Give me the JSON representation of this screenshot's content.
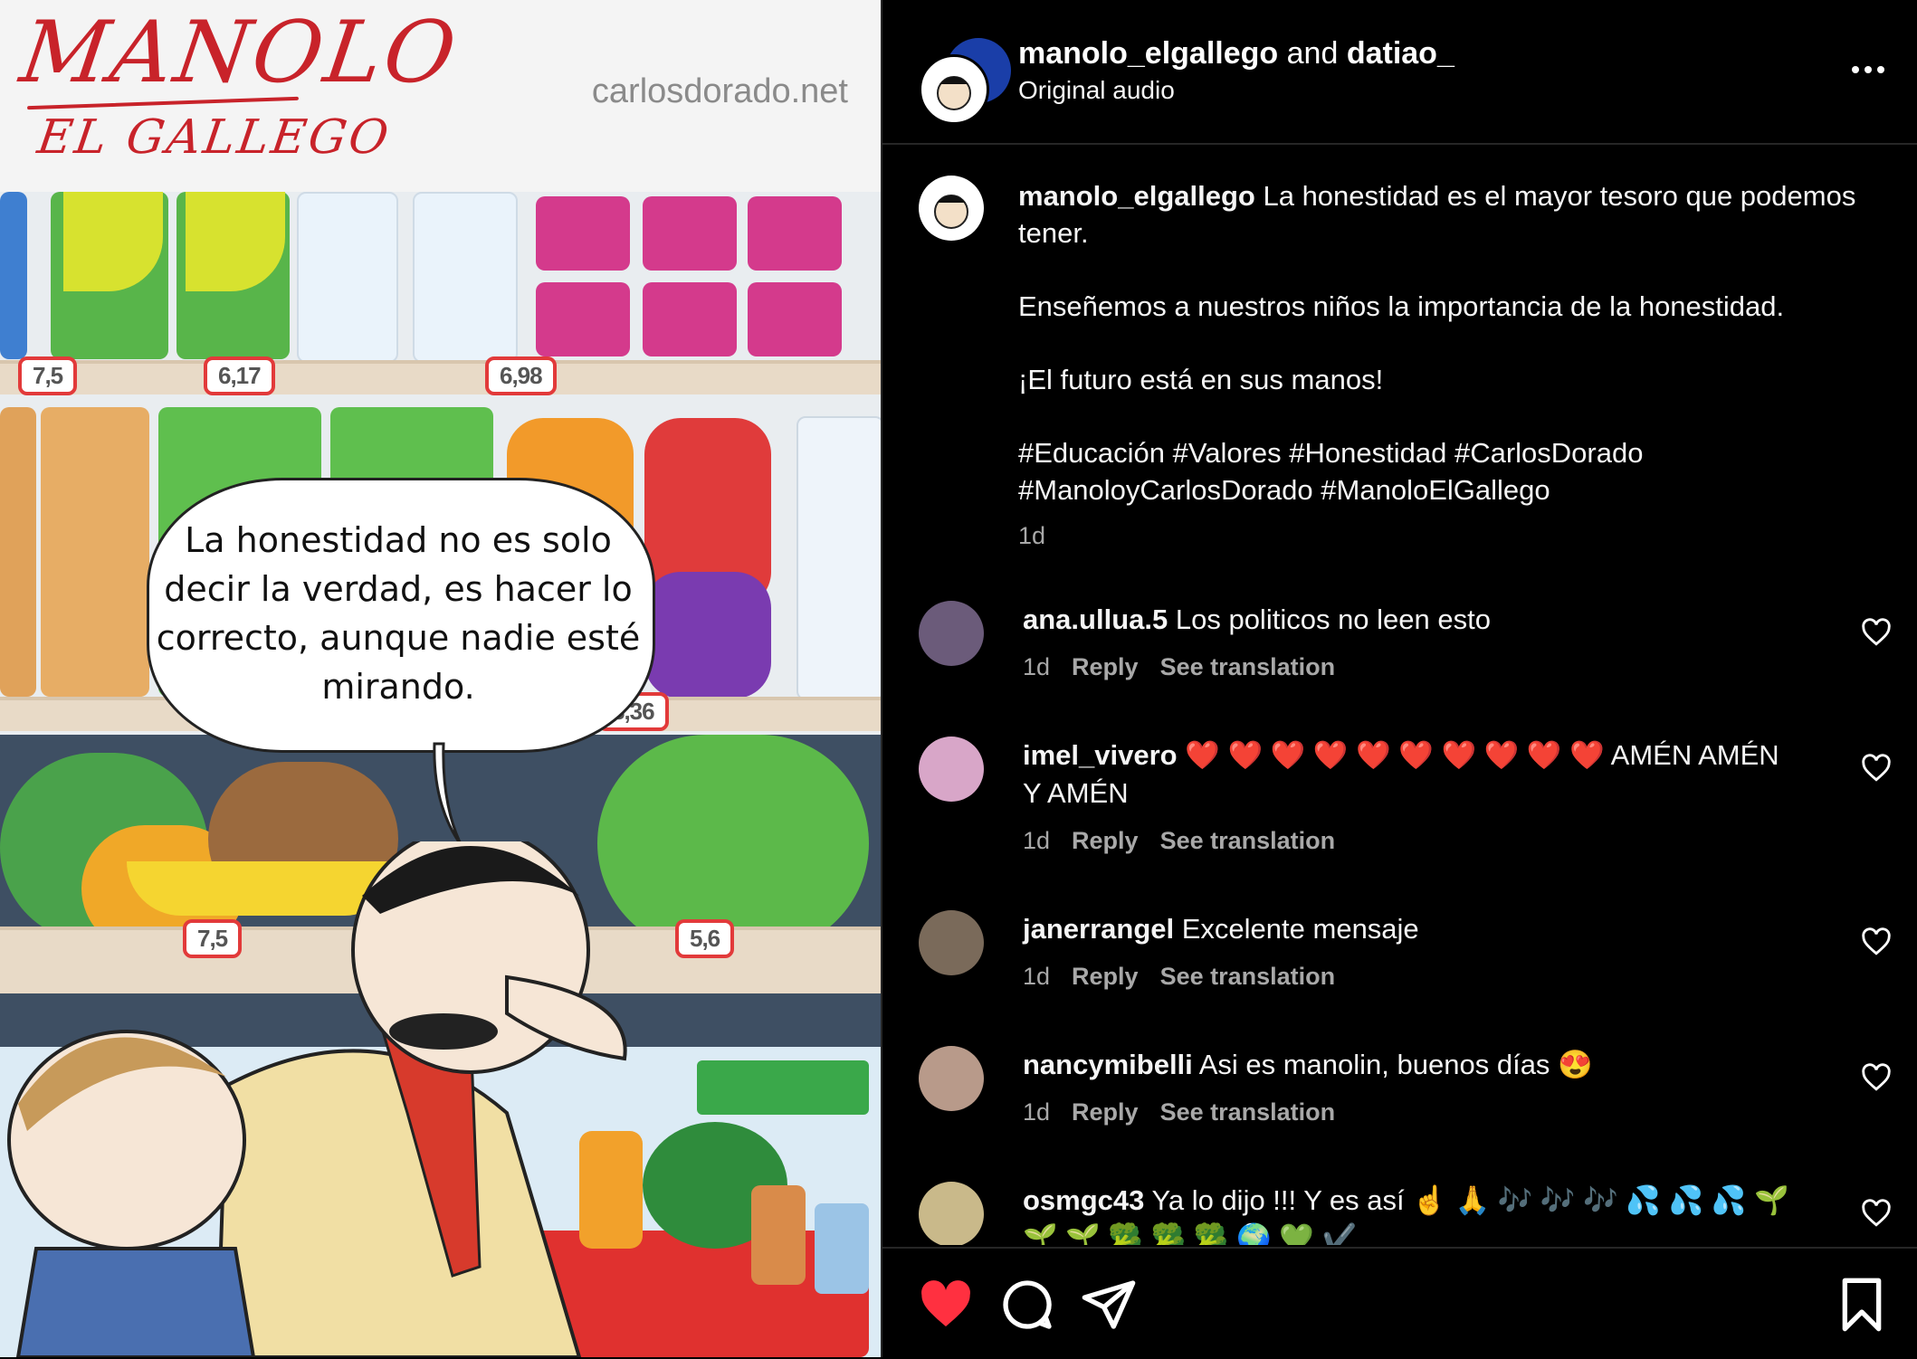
{
  "comic": {
    "logo_main": "MANOLO",
    "logo_sub": "EL GALLEGO",
    "site_url": "carlosdorado.net",
    "prices": [
      "7,5",
      "6,17",
      "6,98",
      "8,36",
      "7,5",
      "5,6"
    ],
    "bubble_lines": [
      "La honestidad no es solo",
      "decir la verdad, es hacer lo",
      "correcto, aunque nadie esté",
      "mirando."
    ]
  },
  "header": {
    "user1": "manolo_elgallego",
    "and": "and",
    "user2": "datiao_",
    "subtitle": "Original audio",
    "more_icon": "more-horizontal-icon"
  },
  "caption": {
    "username": "manolo_elgallego",
    "line1": "La honestidad es el mayor tesoro que podemos tener.",
    "line2": "Enseñemos a nuestros niños la importancia de la honestidad.",
    "line3": "¡El futuro está en sus manos!",
    "hashtags": "#Educación #Valores #Honestidad #CarlosDorado #ManoloyCarlosDorado #ManoloElGallego",
    "time": "1d"
  },
  "comments": [
    {
      "username": "ana.ullua.5",
      "text": "Los politicos no leen esto",
      "time": "1d",
      "reply": "Reply",
      "translate": "See translation",
      "avatar_color": "#6b5b7a"
    },
    {
      "username": "imel_vivero",
      "text": "❤️ ❤️ ❤️ ❤️ ❤️ ❤️ ❤️ ❤️ ❤️ ❤️ AMÉN AMÉN Y AMÉN",
      "time": "1d",
      "reply": "Reply",
      "translate": "See translation",
      "avatar_color": "#d8a6c8"
    },
    {
      "username": "janerrangel",
      "text": "Excelente mensaje",
      "time": "1d",
      "reply": "Reply",
      "translate": "See translation",
      "avatar_color": "#7a6a5a"
    },
    {
      "username": "nancymibelli",
      "text": "Asi es manolin, buenos días 😍",
      "time": "1d",
      "reply": "Reply",
      "translate": "See translation",
      "avatar_color": "#b89a8a"
    },
    {
      "username": "osmgc43",
      "text": "Ya lo dijo !!! Y es así ☝️ 🙏 🎶 🎶 🎶 💦 💦 💦 🌱 🌱 🌱 🥦 🥦 🥦 🌍 💚 ✔️",
      "avatar_color": "#c9b98a"
    }
  ],
  "actions": {
    "like_icon": "heart-filled-icon",
    "comment_icon": "comment-icon",
    "share_icon": "send-icon",
    "save_icon": "bookmark-icon",
    "like_color": "#ff3040"
  }
}
